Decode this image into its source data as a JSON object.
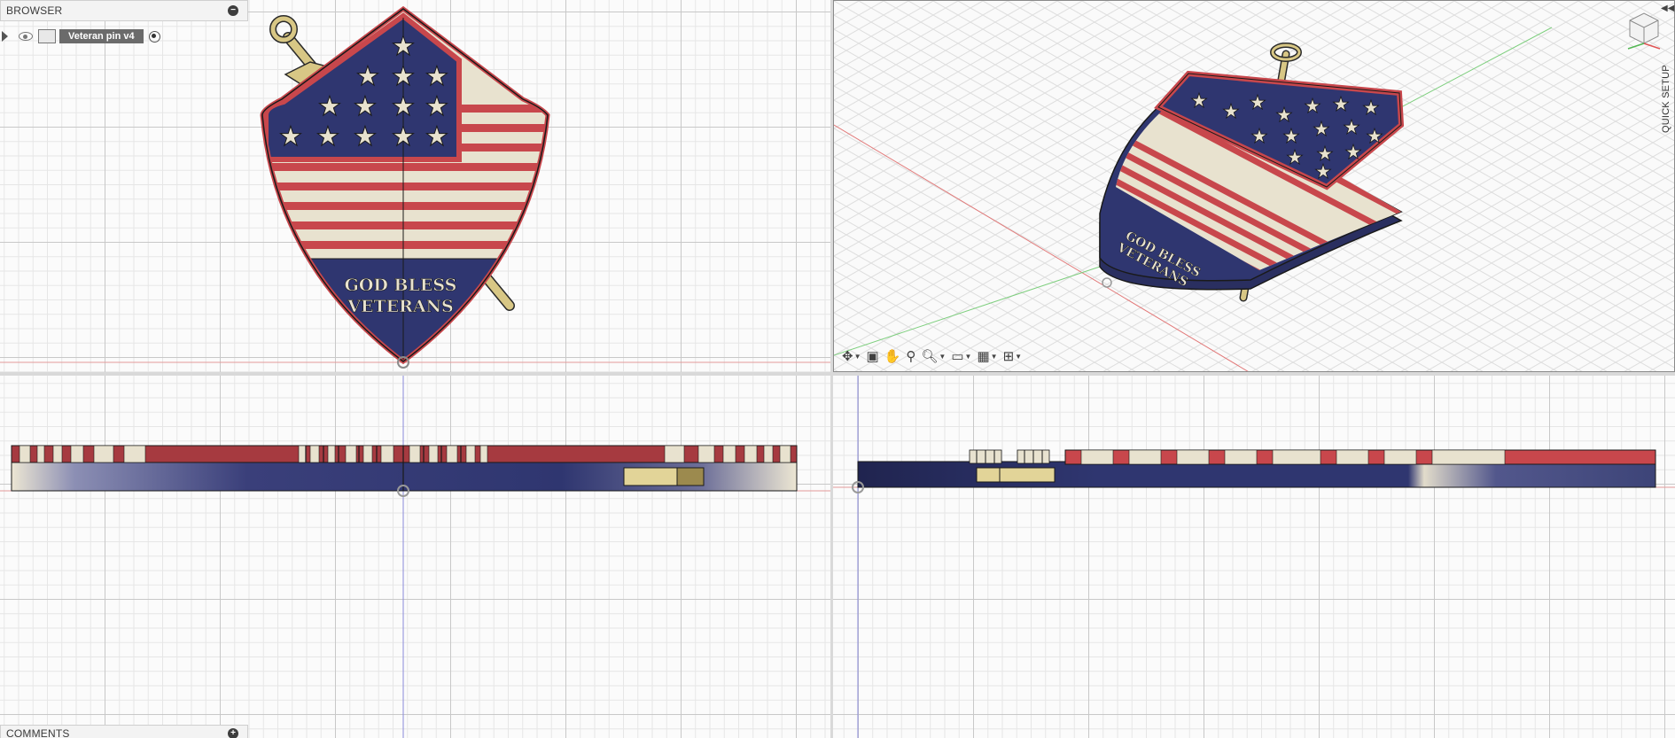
{
  "browser": {
    "title": "BROWSER",
    "component_label": "Veteran pin v4"
  },
  "comments": {
    "title": "COMMENTS"
  },
  "design": {
    "text_line1": "GOD BLESS",
    "text_line2": "VETERANS"
  },
  "quick_setup_label": "QUICK SETUP",
  "colors": {
    "navy": "#2f3670",
    "red": "#c8474c",
    "cream": "#e8e2cf",
    "gold": "#d8c785",
    "outline": "#1a1a1a"
  },
  "icons": {
    "panel_collapse": "minus-circle-icon",
    "comments_add": "plus-circle-icon",
    "nav_orbit": "orbit-icon",
    "nav_look": "look-at-icon",
    "nav_pan": "pan-hand-icon",
    "nav_zoom": "zoom-icon",
    "nav_fit": "fit-icon",
    "display": "display-settings-icon",
    "grid": "grid-icon",
    "viewports": "multi-viewport-icon"
  }
}
